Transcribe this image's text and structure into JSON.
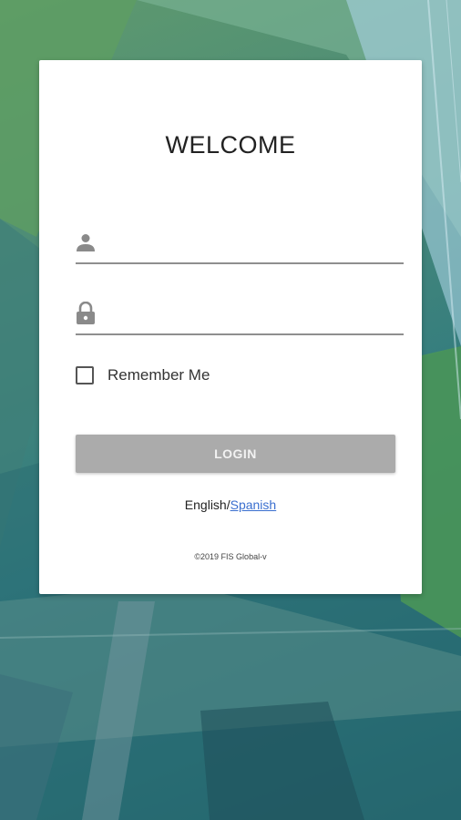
{
  "login": {
    "title": "WELCOME",
    "username": {
      "value": "",
      "placeholder": ""
    },
    "password": {
      "value": "",
      "placeholder": ""
    },
    "remember_label": "Remember Me",
    "remember_checked": false,
    "login_label": "LOGIN",
    "language": {
      "current": "English",
      "separator": "/",
      "other": "Spanish"
    },
    "copyright": "©2019 FIS Global-v"
  },
  "theme": {
    "card_bg": "#ffffff",
    "button_disabled": "#ababab",
    "link": "#3a6fcf",
    "underline": "#8f8f8f"
  },
  "icons": {
    "username": "person-icon",
    "password": "lock-icon"
  }
}
